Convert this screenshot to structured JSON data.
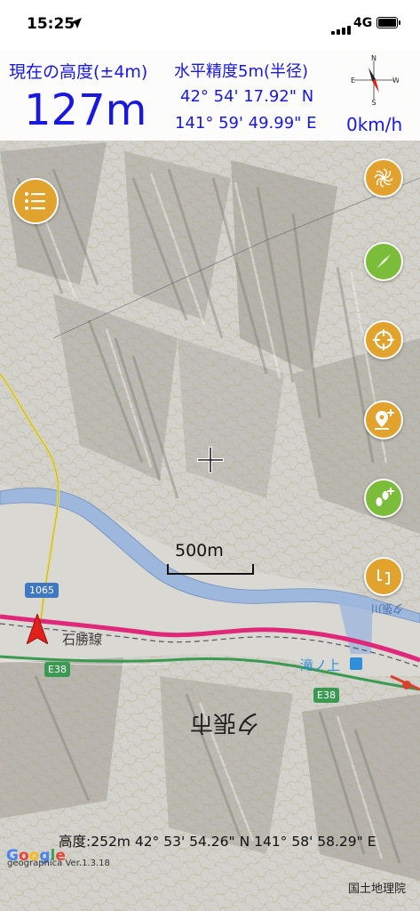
{
  "status_bar": {
    "time": "15:25",
    "network": "4G"
  },
  "header": {
    "altitude_label": "現在の高度(±4m)",
    "altitude_value": "127m",
    "accuracy_label": "水平精度5m(半径)",
    "latitude": "42° 54' 17.92\" N",
    "longitude": "141° 59' 49.99\" E",
    "speed": "0km/h",
    "compass": {
      "n": "N",
      "s": "S",
      "e": "E",
      "w": "W"
    }
  },
  "map": {
    "scale_label": "500m",
    "labels": {
      "rail_line": "石勝線",
      "station": "滝ノ上",
      "town": "夕張市",
      "river_right": "夕張川",
      "route_1065": "1065",
      "expressway_left": "E38",
      "expressway_right": "E38"
    },
    "cursor_info": "高度:252m  42° 53' 54.26\" N 141° 58' 58.29\" E",
    "attribution_google": "Google",
    "app_version": "geographica Ver.1.3.18",
    "attribution_gsi": "国土地理院"
  },
  "buttons": {
    "menu": "menu-icon",
    "right": [
      "spiral-icon",
      "compass-icon",
      "target-icon",
      "add-pin-icon",
      "add-track-icon",
      "route-icon"
    ]
  },
  "colors": {
    "accent_blue": "#1818e0",
    "button_orange": "#e2a22e",
    "button_green": "#7bbd3a",
    "rail_pink": "#e0287a",
    "river_blue": "#9db7dd",
    "expressway_green": "#3a9a52"
  }
}
